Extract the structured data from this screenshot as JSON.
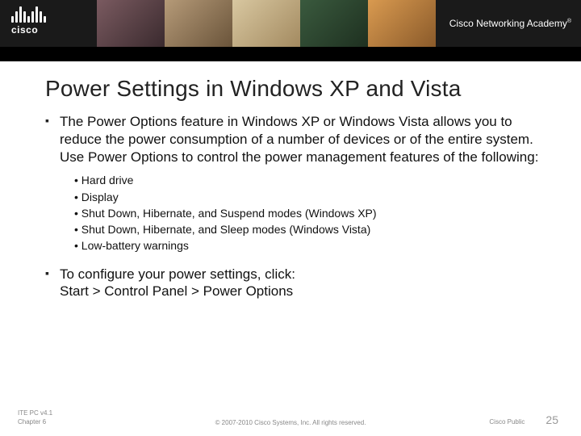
{
  "header": {
    "brand": "cisco",
    "academy": "Cisco Networking Academy",
    "tm": "®"
  },
  "title": "Power Settings in Windows XP and Vista",
  "bullets": [
    {
      "text": "The Power Options feature in Windows XP or Windows Vista allows you to reduce the power consumption of a number of devices or of the entire system. Use Power Options to control the power management features of the following:",
      "sub": [
        "Hard drive",
        "Display",
        "Shut Down, Hibernate, and Suspend modes (Windows XP)",
        "Shut Down, Hibernate, and Sleep modes (Windows Vista)",
        "Low-battery warnings"
      ]
    },
    {
      "text": "To configure your power settings, click:",
      "path": "Start > Control Panel > Power Options"
    }
  ],
  "footer": {
    "course": "ITE PC v4.1",
    "chapter": "Chapter 6",
    "copyright": "© 2007-2010 Cisco Systems, Inc. All rights reserved.",
    "classification": "Cisco Public",
    "page": "25"
  }
}
